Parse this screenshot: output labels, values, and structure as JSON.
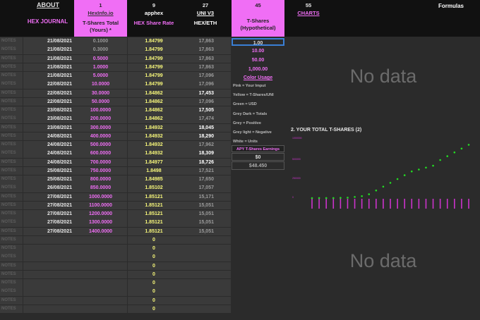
{
  "header": {
    "about": "ABOUT",
    "col1": {
      "num": "1",
      "link": "HexInfo.io",
      "title": "T-Shares Total (Yours) *"
    },
    "col2": {
      "num": "9",
      "link": "apphex",
      "title": "HEX Share Rate"
    },
    "col3": {
      "num": "27",
      "link": "UNI V3",
      "title": "HEX/ETH"
    },
    "col4": {
      "num": "45",
      "title": "T-Shares (Hypothetical)"
    },
    "col5": {
      "num": "55",
      "link": "CHARTS"
    },
    "formulas": "Formulas",
    "journal": "HEX JOURNAL"
  },
  "note_label": "NOTES",
  "rows": [
    {
      "date": "21/08/2021",
      "tshares": "0.1000",
      "rate": "1.84799",
      "eth": "17,863",
      "grey_ts": true,
      "eth_style": "grey"
    },
    {
      "date": "21/08/2021",
      "tshares": "0.3000",
      "rate": "1.84799",
      "eth": "17,863",
      "grey_ts": true,
      "eth_style": "grey"
    },
    {
      "date": "21/08/2021",
      "tshares": "0.5000",
      "rate": "1.84799",
      "eth": "17,863",
      "eth_style": "grey"
    },
    {
      "date": "21/08/2021",
      "tshares": "1.0000",
      "rate": "1.84799",
      "eth": "17,863",
      "eth_style": "grey"
    },
    {
      "date": "21/08/2021",
      "tshares": "5.0000",
      "rate": "1.84799",
      "eth": "17,096",
      "eth_style": "grey"
    },
    {
      "date": "22/08/2021",
      "tshares": "10.0000",
      "rate": "1.84799",
      "eth": "17,096",
      "eth_style": "grey"
    },
    {
      "date": "22/08/2021",
      "tshares": "30.0000",
      "rate": "1.84862",
      "eth": "17,453",
      "eth_style": "white"
    },
    {
      "date": "22/08/2021",
      "tshares": "50.0000",
      "rate": "1.84862",
      "eth": "17,096",
      "eth_style": "grey"
    },
    {
      "date": "23/08/2021",
      "tshares": "100.0000",
      "rate": "1.84862",
      "eth": "17,505",
      "eth_style": "white"
    },
    {
      "date": "23/08/2021",
      "tshares": "200.0000",
      "rate": "1.84862",
      "eth": "17,474",
      "eth_style": "grey"
    },
    {
      "date": "23/08/2021",
      "tshares": "300.0000",
      "rate": "1.84932",
      "eth": "18,045",
      "eth_style": "white"
    },
    {
      "date": "24/08/2021",
      "tshares": "400.0000",
      "rate": "1.84932",
      "eth": "18,290",
      "eth_style": "white"
    },
    {
      "date": "24/08/2021",
      "tshares": "500.0000",
      "rate": "1.84932",
      "eth": "17,962",
      "eth_style": "grey"
    },
    {
      "date": "24/08/2021",
      "tshares": "600.0000",
      "rate": "1.84932",
      "eth": "18,309",
      "eth_style": "white"
    },
    {
      "date": "24/08/2021",
      "tshares": "700.0000",
      "rate": "1.84977",
      "eth": "18,726",
      "eth_style": "white"
    },
    {
      "date": "25/08/2021",
      "tshares": "750.0000",
      "rate": "1.8498",
      "eth": "17,521",
      "eth_style": "grey"
    },
    {
      "date": "25/08/2021",
      "tshares": "800.0000",
      "rate": "1.84985",
      "eth": "17,650",
      "eth_style": "grey"
    },
    {
      "date": "26/08/2021",
      "tshares": "850.0000",
      "rate": "1.85102",
      "eth": "17,057",
      "eth_style": "grey"
    },
    {
      "date": "27/08/2021",
      "tshares": "1000.0000",
      "rate": "1.85121",
      "eth": "15,171",
      "eth_style": "grey"
    },
    {
      "date": "27/08/2021",
      "tshares": "1100.0000",
      "rate": "1.85121",
      "eth": "15,051",
      "eth_style": "grey"
    },
    {
      "date": "27/08/2021",
      "tshares": "1200.0000",
      "rate": "1.85121",
      "eth": "15,051",
      "eth_style": "grey"
    },
    {
      "date": "27/08/2021",
      "tshares": "1300.0000",
      "rate": "1.85121",
      "eth": "15,051",
      "eth_style": "grey"
    },
    {
      "date": "27/08/2021",
      "tshares": "1400.0000",
      "rate": "1.85121",
      "eth": "15,051",
      "eth_style": "grey"
    },
    {
      "date": "",
      "tshares": "",
      "rate": "0",
      "eth": ""
    },
    {
      "date": "",
      "tshares": "",
      "rate": "0",
      "eth": ""
    },
    {
      "date": "",
      "tshares": "",
      "rate": "0",
      "eth": ""
    },
    {
      "date": "",
      "tshares": "",
      "rate": "0",
      "eth": ""
    },
    {
      "date": "",
      "tshares": "",
      "rate": "0",
      "eth": ""
    },
    {
      "date": "",
      "tshares": "",
      "rate": "0",
      "eth": ""
    },
    {
      "date": "",
      "tshares": "",
      "rate": "0",
      "eth": ""
    },
    {
      "date": "",
      "tshares": "",
      "rate": "0",
      "eth": ""
    },
    {
      "date": "",
      "tshares": "",
      "rate": "0",
      "eth": ""
    }
  ],
  "hypothetical": {
    "values": [
      "1.00",
      "10.00",
      "50.00",
      "1,000.00"
    ],
    "color_usage": "Color Usage",
    "legend": [
      {
        "text": "Pink = Your Imput",
        "color": "#bbbbbb"
      },
      {
        "text": "Yellow = T-Shares/UNI",
        "color": "#bbbbbb"
      },
      {
        "text": "Green = USD",
        "color": "#bbbbbb"
      },
      {
        "text": "Grey Dark = Totals",
        "color": "#bbbbbb"
      },
      {
        "text": "Grey = Positive",
        "color": "#bbbbbb"
      },
      {
        "text": "Grey light = Negative",
        "color": "#bbbbbb"
      },
      {
        "text": "White = Units",
        "color": "#bbbbbb"
      }
    ],
    "apy_label": "APY T-Shares Earnings",
    "apy_value": "$0",
    "usd_value": "$48.450"
  },
  "panel": {
    "no_data_top": "No data",
    "chart_title": "2. YOUR TOTAL T-SHARES (2)",
    "no_data_bottom": "No data"
  },
  "chart_data": {
    "type": "line",
    "title": "2. YOUR TOTAL T-SHARES (2)",
    "x": [
      "21/08/2021",
      "21/08/2021",
      "21/08/2021",
      "21/08/2021",
      "21/08/2021",
      "22/08/2021",
      "22/08/2021",
      "22/08/2021",
      "23/08/2021",
      "23/08/2021",
      "23/08/2021",
      "24/08/2021",
      "24/08/2021",
      "24/08/2021",
      "24/08/2021",
      "25/08/2021",
      "25/08/2021",
      "26/08/2021",
      "27/08/2021",
      "27/08/2021",
      "27/08/2021",
      "27/08/2021",
      "27/08/2021"
    ],
    "series": [
      {
        "values": [
          0.1,
          0.3,
          0.5,
          1,
          5,
          10,
          30,
          50,
          100,
          200,
          300,
          400,
          500,
          600,
          700,
          750,
          800,
          850,
          1000,
          1100,
          1200,
          1300,
          1400
        ]
      }
    ],
    "ylim": [
      0,
      1500
    ],
    "grid": false,
    "colors": {
      "points": "#22dd22",
      "ticks": "#cc33cc"
    }
  }
}
